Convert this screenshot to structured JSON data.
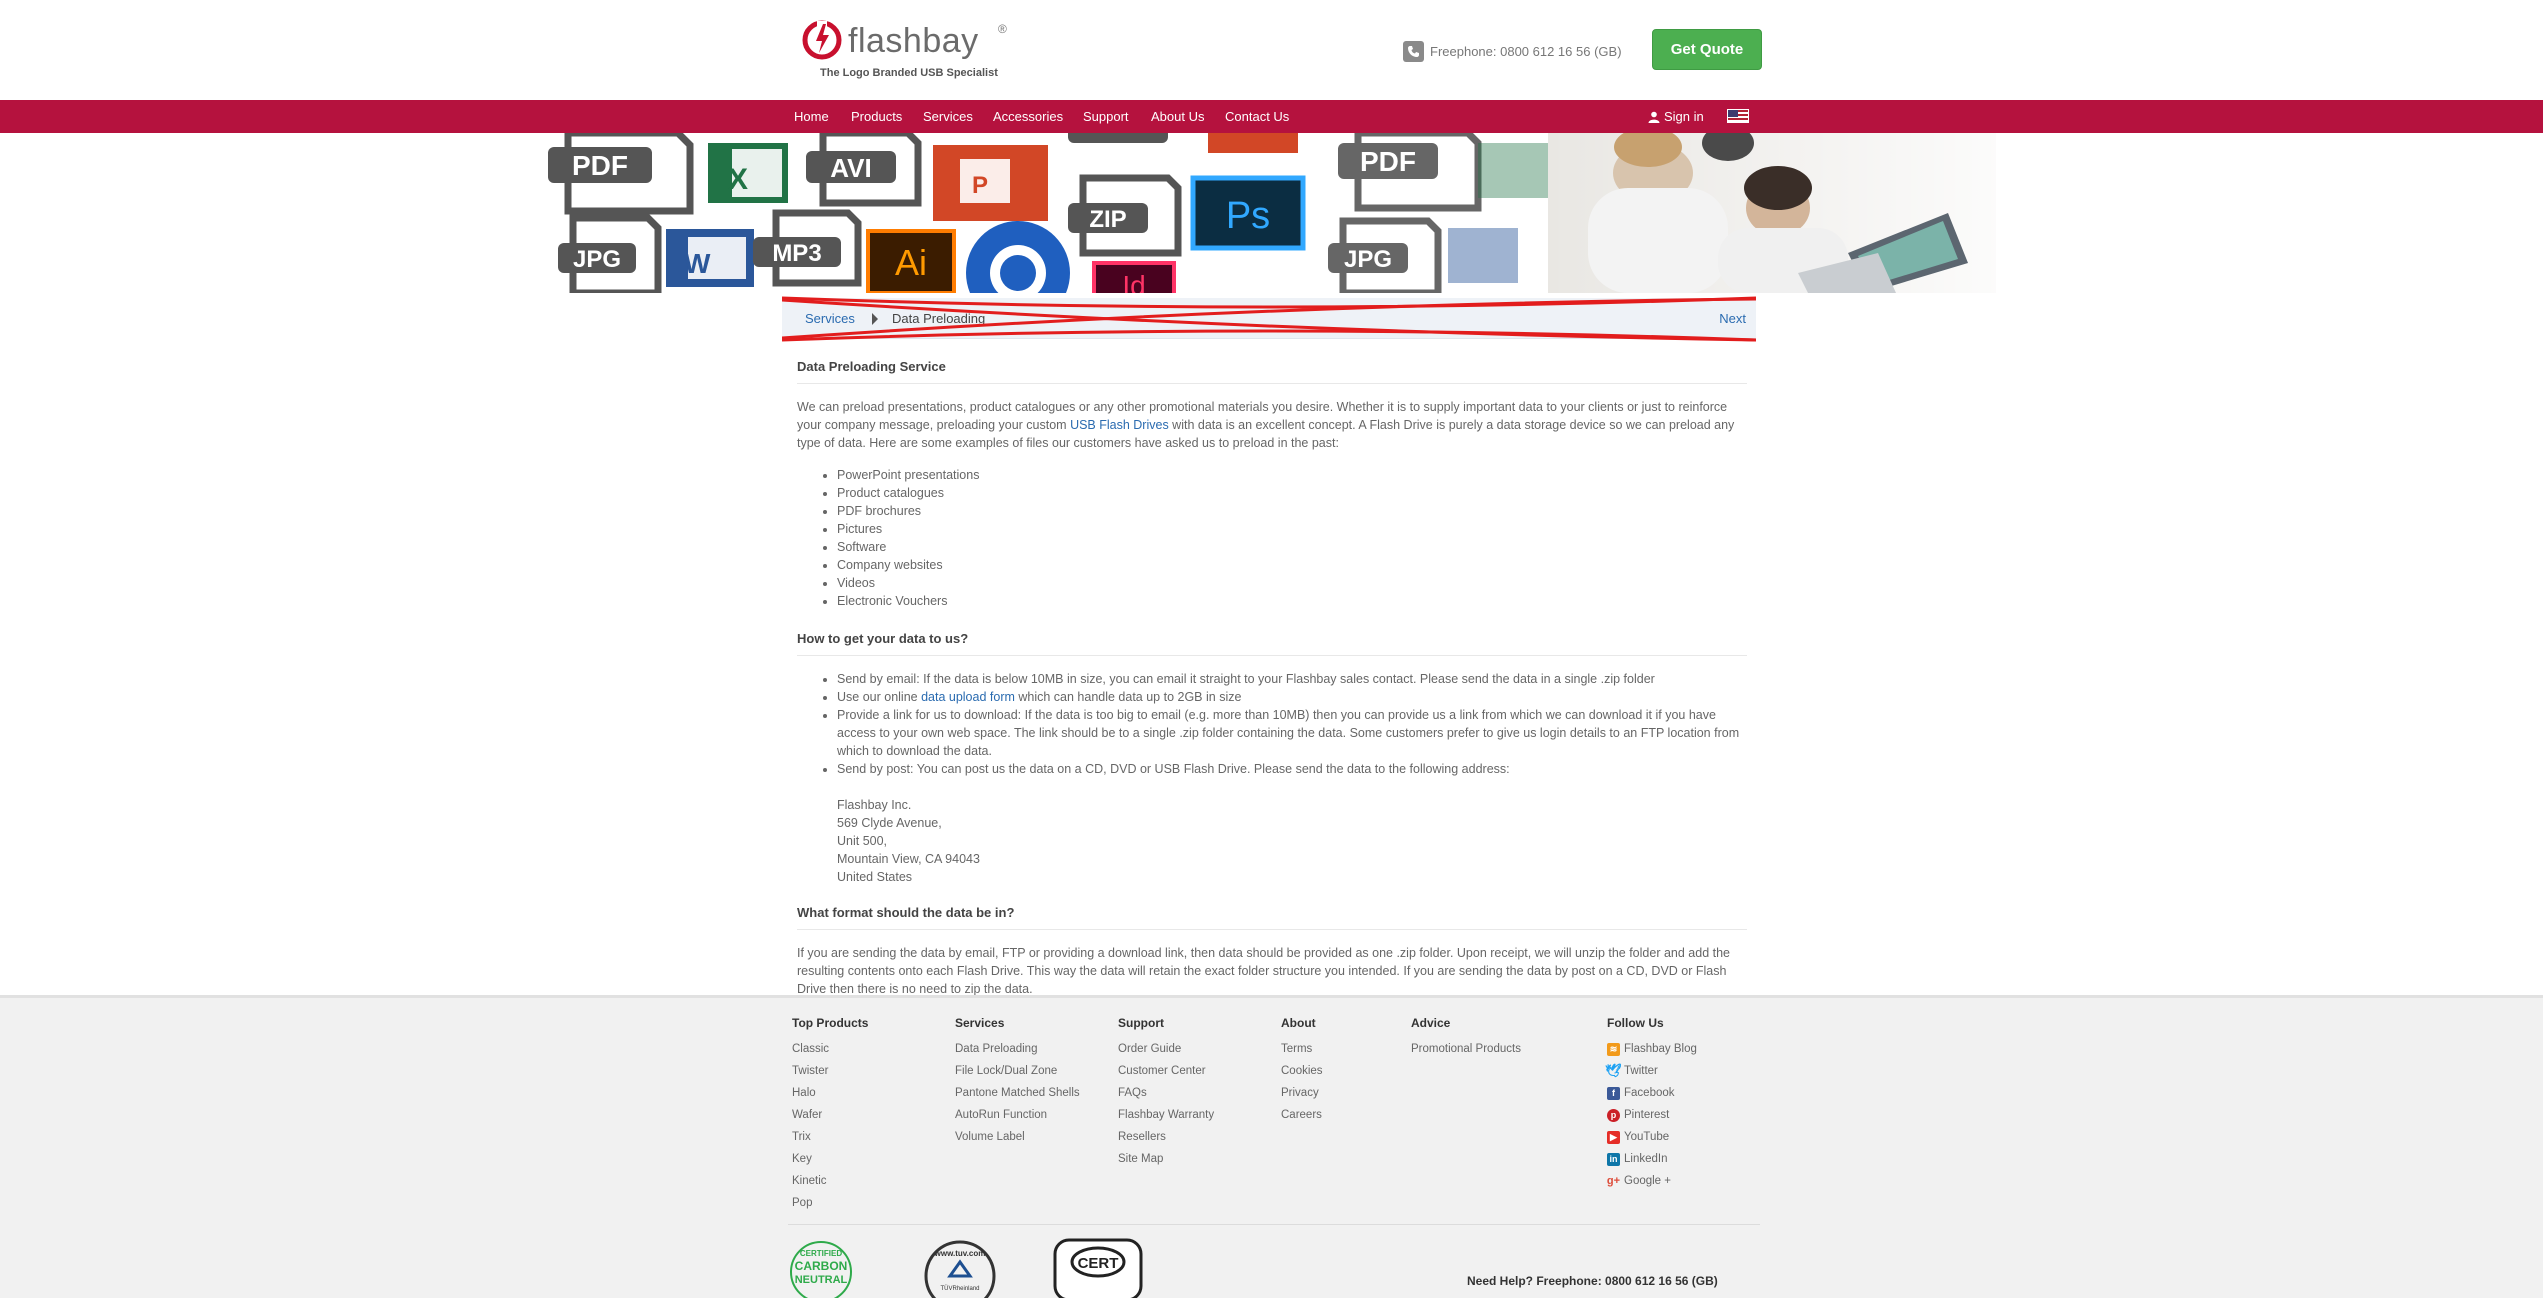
{
  "header": {
    "logo_text": "flashbay",
    "logo_reg": "®",
    "logo_tagline": "The Logo Branded USB Specialist",
    "phone_text": "Freephone: 0800 612 16 56 (GB)",
    "quote_label": "Get Quote"
  },
  "nav": {
    "items": [
      "Home",
      "Products",
      "Services",
      "Accessories",
      "Support",
      "About Us",
      "Contact Us"
    ],
    "sign_in": "Sign in"
  },
  "banner": {
    "file_labels": [
      "PDF",
      "AVI",
      "JPG",
      "MP3",
      "ZIP",
      "Ps",
      "Ai",
      "PDF",
      "JPG",
      "Id"
    ]
  },
  "breadcrumb": {
    "parent": "Services",
    "current": "Data Preloading",
    "next": "Next"
  },
  "content": {
    "title1": "Data Preloading Service",
    "intro_a": "We can preload presentations, product catalogues or any other promotional materials you desire. Whether it is to supply important data to your clients or just to reinforce your company message, preloading your custom ",
    "intro_link": "USB Flash Drives",
    "intro_b": " with data is an excellent concept. A Flash Drive is purely a data storage device so we can preload any type of data. Here are some examples of files our customers have asked us to preload in the past:",
    "examples": [
      "PowerPoint presentations",
      "Product catalogues",
      "PDF brochures",
      "Pictures",
      "Software",
      "Company websites",
      "Videos",
      "Electronic Vouchers"
    ],
    "title2": "How to get your data to us?",
    "how1": "Send by email: If the data is below 10MB in size, you can email it straight to your Flashbay sales contact. Please send the data in a single .zip folder",
    "how2_a": "Use our online ",
    "how2_link": "data upload form",
    "how2_b": " which can handle data up to 2GB in size",
    "how3": "Provide a link for us to download: If the data is too big to email (e.g. more than 10MB) then you can provide us a link from which we can download it if you have access to your own web space. The link should be to a single .zip folder containing the data. Some customers prefer to give us login details to an FTP location from which to download the data.",
    "how4": "Send by post: You can post us the data on a CD, DVD or USB Flash Drive. Please send the data to the following address:",
    "address": [
      "Flashbay Inc.",
      "569 Clyde Avenue,",
      "Unit 500,",
      "Mountain View, CA 94043",
      "United States"
    ],
    "title3": "What format should the data be in?",
    "format_text": "If you are sending the data by email, FTP or providing a download link, then data should be provided as one .zip folder. Upon receipt, we will unzip the folder and add the resulting contents onto each Flash Drive. This way the data will retain the exact folder structure you intended. If you are sending the data by post on a CD, DVD or Flash Drive then there is no need to zip the data."
  },
  "footer": {
    "columns": [
      {
        "title": "Top Products",
        "items": [
          "Classic",
          "Twister",
          "Halo",
          "Wafer",
          "Trix",
          "Key",
          "Kinetic",
          "Pop"
        ]
      },
      {
        "title": "Services",
        "items": [
          "Data Preloading",
          "File Lock/Dual Zone",
          "Pantone Matched Shells",
          "AutoRun Function",
          "Volume Label"
        ]
      },
      {
        "title": "Support",
        "items": [
          "Order Guide",
          "Customer Center",
          "FAQs",
          "Flashbay Warranty",
          "Resellers",
          "Site Map"
        ]
      },
      {
        "title": "About",
        "items": [
          "Terms",
          "Cookies",
          "Privacy",
          "Careers"
        ]
      },
      {
        "title": "Advice",
        "items": [
          "Promotional Products"
        ]
      }
    ],
    "follow": {
      "title": "Follow Us",
      "items": [
        {
          "label": "Flashbay Blog",
          "icon": "rss-icon",
          "color": "#f29a1a"
        },
        {
          "label": "Twitter",
          "icon": "twitter-icon",
          "color": "#1da1f2"
        },
        {
          "label": "Facebook",
          "icon": "facebook-icon",
          "color": "#3b5998"
        },
        {
          "label": "Pinterest",
          "icon": "pinterest-icon",
          "color": "#cb2027"
        },
        {
          "label": "YouTube",
          "icon": "youtube-icon",
          "color": "#e52d27"
        },
        {
          "label": "LinkedIn",
          "icon": "linkedin-icon",
          "color": "#0e76a8"
        },
        {
          "label": "Google +",
          "icon": "google-plus-icon",
          "color": "#dd4b39"
        }
      ]
    },
    "certs": {
      "carbon": [
        "CERTIFIED",
        "CARBON",
        "NEUTRAL"
      ],
      "tuv_url": "www.tuv.com",
      "tuv_brand": "TÜVRheinland",
      "tuv_cert": "CERT"
    },
    "help_text": "Need Help? Freephone: 0800 612 16 56 (GB)"
  },
  "colors": {
    "brand_red": "#b5123e",
    "quote_green": "#4caf50",
    "link_blue": "#2a6bb0"
  }
}
